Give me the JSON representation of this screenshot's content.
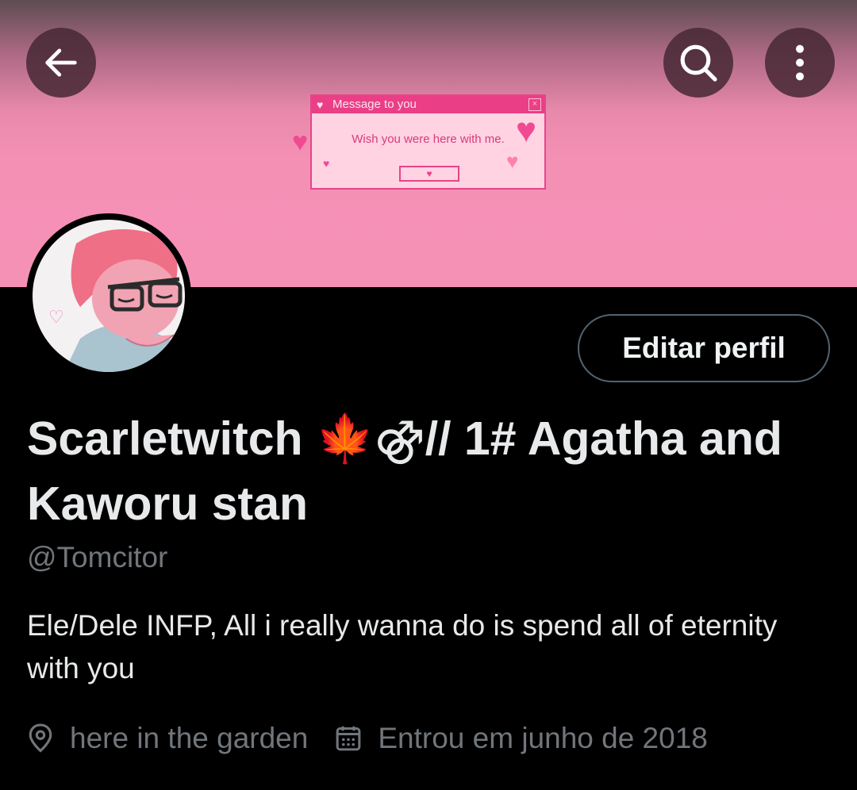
{
  "banner": {
    "message_window": {
      "title": "Message to you",
      "body": "Wish you were here with me.",
      "button": "♥",
      "title_icon": "♥",
      "close_icon": "×"
    },
    "colors": {
      "accent": "#e8438a",
      "background": "#f691b6"
    }
  },
  "header": {
    "back_icon": "arrow-left-icon",
    "search_icon": "search-icon",
    "more_icon": "more-vertical-icon"
  },
  "profile": {
    "edit_button": "Editar perfil",
    "display_name": "Scarletwitch 🍁⚣// 1# Agatha and Kaworu stan",
    "handle": "@Tomcitor",
    "bio": "Ele/Dele INFP,  All i really wanna do is spend all of eternity with you",
    "location": "here in the garden",
    "joined": "Entrou em junho de 2018",
    "location_icon": "location-pin-icon",
    "calendar_icon": "calendar-icon"
  }
}
